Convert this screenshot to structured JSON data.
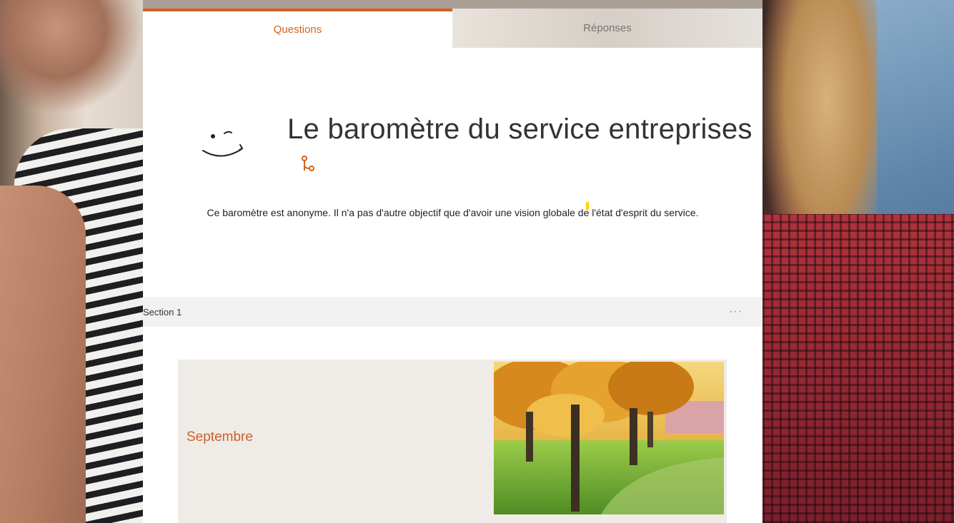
{
  "tabs": {
    "questions": "Questions",
    "responses": "Réponses",
    "active": "questions"
  },
  "form": {
    "title": "Le baromètre du service entreprises",
    "description": "Ce baromètre est anonyme. Il n'a pas d'autre objectif que d'avoir une vision globale de l'état d'esprit du service.",
    "logo_icon": "smiley-icon",
    "branch_icon": "branching-icon"
  },
  "section": {
    "title": "Section 1",
    "more_label": "···"
  },
  "card": {
    "title": "Septembre",
    "image_icon": "autumn-trees-image"
  },
  "colors": {
    "accent": "#d0631c",
    "card_title": "#c8622a",
    "card_bg": "#efebe6",
    "section_bg": "#f1f1f1"
  }
}
